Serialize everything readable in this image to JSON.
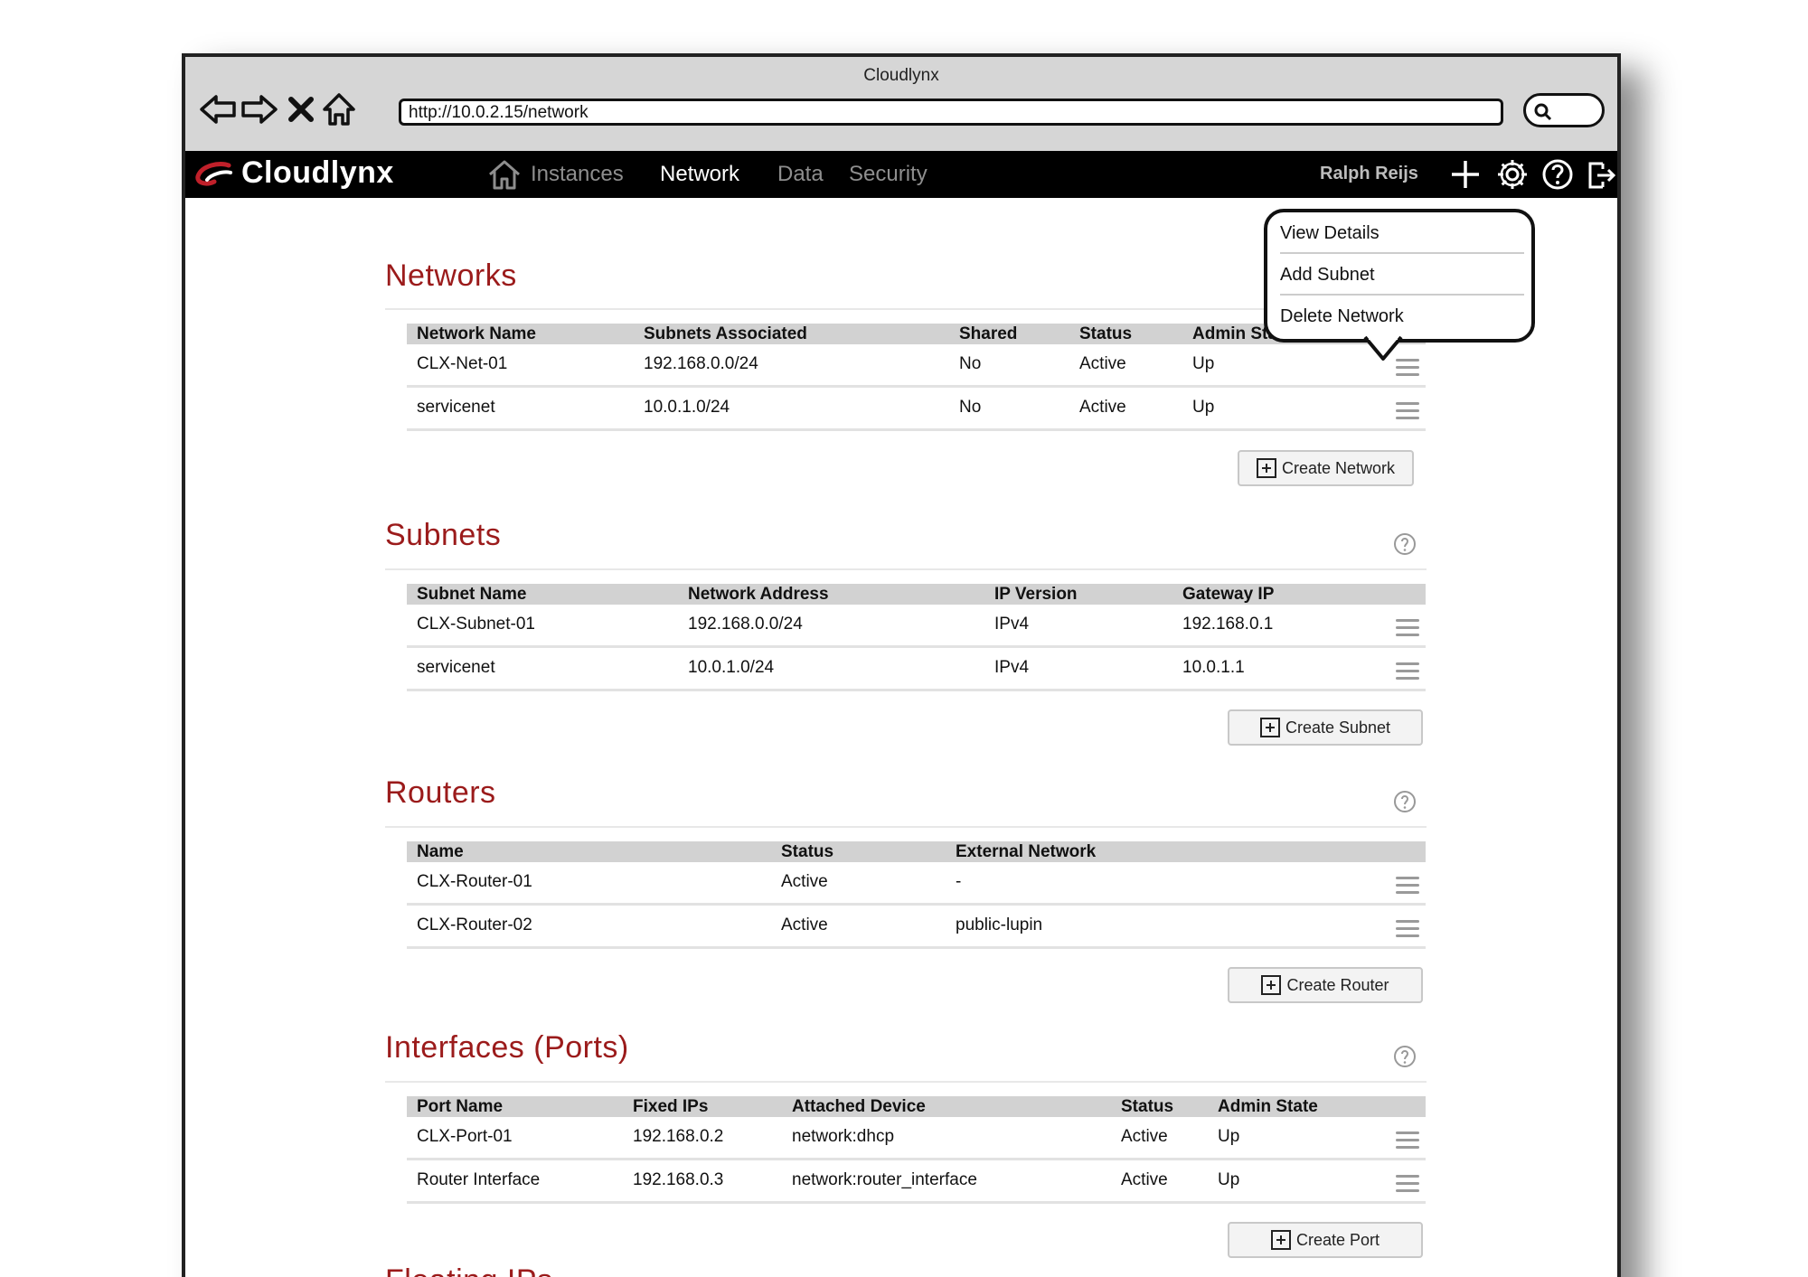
{
  "window": {
    "title": "Cloudlynx"
  },
  "browser": {
    "url": "http://10.0.2.15/network"
  },
  "app": {
    "brand": "Cloudlynx",
    "nav": [
      {
        "label": "Instances"
      },
      {
        "label": "Network"
      },
      {
        "label": "Data"
      },
      {
        "label": "Security"
      }
    ],
    "active_nav": "Network",
    "user": "Ralph Reijs"
  },
  "row_menu": {
    "items": [
      "View Details",
      "Add Subnet",
      "Delete Network"
    ]
  },
  "networks": {
    "title": "Networks",
    "columns": [
      "Network Name",
      "Subnets Associated",
      "Shared",
      "Status",
      "Admin State"
    ],
    "rows": [
      [
        "CLX-Net-01",
        "192.168.0.0/24",
        "No",
        "Active",
        "Up"
      ],
      [
        "servicenet",
        "10.0.1.0/24",
        "No",
        "Active",
        "Up"
      ]
    ],
    "create_label": "Create Network"
  },
  "subnets": {
    "title": "Subnets",
    "columns": [
      "Subnet Name",
      "Network Address",
      "IP Version",
      "Gateway IP"
    ],
    "rows": [
      [
        "CLX-Subnet-01",
        "192.168.0.0/24",
        "IPv4",
        "192.168.0.1"
      ],
      [
        "servicenet",
        "10.0.1.0/24",
        "IPv4",
        "10.0.1.1"
      ]
    ],
    "create_label": "Create Subnet"
  },
  "routers": {
    "title": "Routers",
    "columns": [
      "Name",
      "Status",
      "External Network"
    ],
    "rows": [
      [
        "CLX-Router-01",
        "Active",
        "-"
      ],
      [
        "CLX-Router-02",
        "Active",
        "public-lupin"
      ]
    ],
    "create_label": "Create Router"
  },
  "ports": {
    "title": "Interfaces (Ports)",
    "columns": [
      "Port Name",
      "Fixed IPs",
      "Attached Device",
      "Status",
      "Admin State"
    ],
    "rows": [
      [
        "CLX-Port-01",
        "192.168.0.2",
        "network:dhcp",
        "Active",
        "Up"
      ],
      [
        "Router Interface",
        "192.168.0.3",
        "network:router_interface",
        "Active",
        "Up"
      ]
    ],
    "create_label": "Create Port"
  },
  "floating": {
    "title": "Floating IPs"
  },
  "colors": {
    "section_title": "#9b1b1b",
    "topbar": "#000000",
    "accent_logo": "#c0202a"
  }
}
